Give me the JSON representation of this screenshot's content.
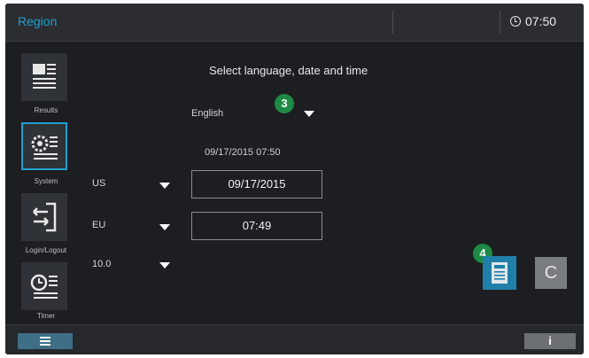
{
  "header": {
    "title": "Region",
    "clock_time": "07:50"
  },
  "sidebar": {
    "items": [
      {
        "label": "Results",
        "icon": "results-icon"
      },
      {
        "label": "System",
        "icon": "system-icon",
        "active": true
      },
      {
        "label": "Login/Logout",
        "icon": "login-logout-icon"
      },
      {
        "label": "Timer",
        "icon": "timer-icon"
      }
    ]
  },
  "main": {
    "heading": "Select language, date and time",
    "language": "English",
    "current_datetime": "09/17/2015 07:50",
    "date_format": "US",
    "date_value": "09/17/2015",
    "time_format": "EU",
    "time_value": "07:49",
    "third_setting": "10.0"
  },
  "callouts": {
    "badge_3": "3",
    "badge_4": "4"
  },
  "actions": {
    "cancel_label": "C"
  },
  "footer": {
    "info_label": "i"
  },
  "colors": {
    "accent": "#1f9fd0",
    "callout": "#1e8a45",
    "background": "#1d1e21"
  }
}
